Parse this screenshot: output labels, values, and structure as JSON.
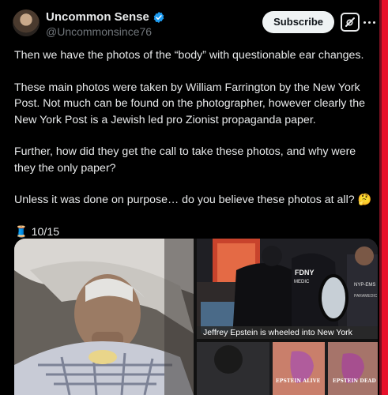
{
  "author": {
    "display_name": "Uncommon Sense",
    "handle": "@Uncommonsince76"
  },
  "actions": {
    "subscribe_label": "Subscribe"
  },
  "post": {
    "paragraphs": [
      "Then we have the photos of the “body” with questionable ear changes.",
      "These main photos were taken by William Farrington by the New York Post. Not much can be found on the photographer, however clearly the New York Post is a Jewish led pro Zionist propaganda paper.",
      "Further, how did they get the call to take these photos, and why were they the only paper?",
      "Unless it was done on purpose… do you believe these photos at all? 🤔",
      "🧵 10/15"
    ]
  },
  "media": {
    "caption": "Jeffrey Epstein is wheeled into New York",
    "vest_text": "FDNY",
    "vest_subtext": "MEDIC",
    "badge_text": "NYP-EMS",
    "badge_subtext": "PARAMEDIC",
    "label_alive": "EPSTEIN ALIVE",
    "label_dead": "EPSTEIN DEAD"
  },
  "colors": {
    "background": "#000000",
    "text": "#e7e9ea",
    "secondary": "#71767b",
    "verified": "#1d9bf0",
    "subscribe_bg": "#eff3f4"
  }
}
